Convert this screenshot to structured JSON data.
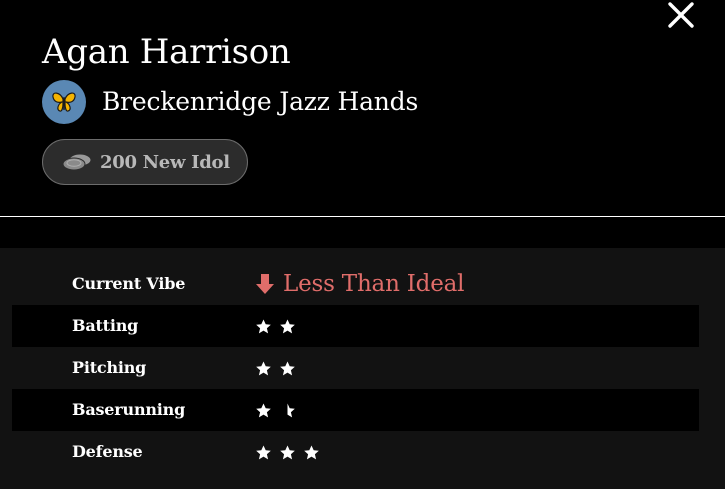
{
  "player": {
    "name": "Agan Harrison",
    "team": "Breckenridge Jazz Hands",
    "team_emoji": "butterfly-icon",
    "team_color": "#5a88b4",
    "item": "200 New Idol",
    "item_icon": "coins-icon"
  },
  "controls": {
    "close_icon": "close-icon"
  },
  "vibe": {
    "label": "Current Vibe",
    "value": "Less Than Ideal",
    "icon": "arrow-down-icon",
    "color": "#e06d6a"
  },
  "stats": [
    {
      "label": "Batting",
      "stars": 2
    },
    {
      "label": "Pitching",
      "stars": 2
    },
    {
      "label": "Baserunning",
      "stars": 1.5
    },
    {
      "label": "Defense",
      "stars": 3
    }
  ]
}
